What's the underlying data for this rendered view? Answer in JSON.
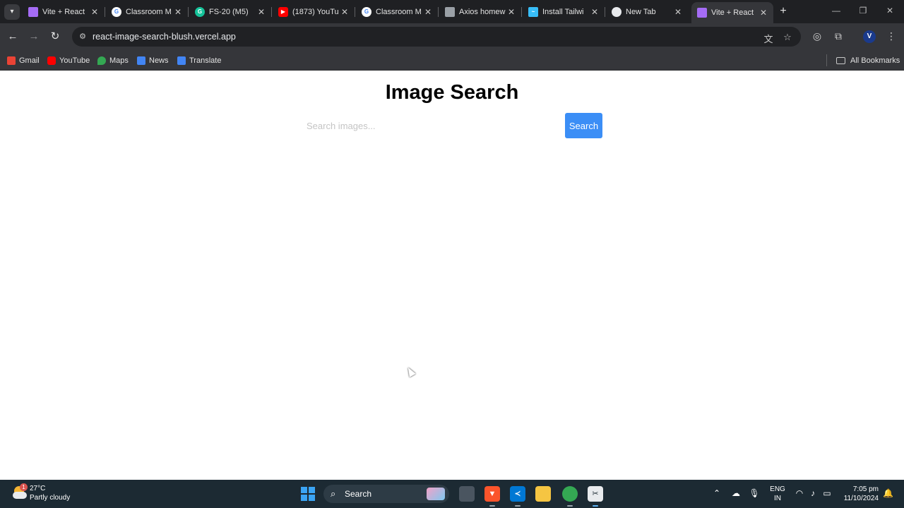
{
  "browser": {
    "tabs": [
      {
        "title": "Vite + React",
        "favicon": "vite-icon",
        "color": "#a56cf5"
      },
      {
        "title": "Classroom M",
        "favicon": "google-icon",
        "color": "#ffffff"
      },
      {
        "title": "FS-20 (M5)",
        "favicon": "grammarly-icon",
        "color": "#15c39a"
      },
      {
        "title": "(1873) YouTu",
        "favicon": "youtube-icon",
        "color": "#ff0000"
      },
      {
        "title": "Classroom M",
        "favicon": "google-icon",
        "color": "#ffffff"
      },
      {
        "title": "Axios homew",
        "favicon": "image-icon",
        "color": "#9aa0a6"
      },
      {
        "title": "Install Tailwi",
        "favicon": "tailwind-icon",
        "color": "#38bdf8"
      },
      {
        "title": "New Tab",
        "favicon": "chrome-icon",
        "color": "#e8eaed"
      },
      {
        "title": "Vite + React",
        "favicon": "vite-icon",
        "color": "#a56cf5",
        "active": true
      }
    ],
    "address_bar": {
      "url": "react-image-search-blush.vercel.app"
    },
    "bookmarks": [
      {
        "label": "Gmail",
        "color": "#ea4335"
      },
      {
        "label": "YouTube",
        "color": "#ff0000"
      },
      {
        "label": "Maps",
        "color": "#34a853"
      },
      {
        "label": "News",
        "color": "#4285f4"
      },
      {
        "label": "Translate",
        "color": "#4285f4"
      }
    ],
    "all_bookmarks_label": "All Bookmarks",
    "profile_initial": "V"
  },
  "page": {
    "title": "Image Search",
    "search": {
      "placeholder": "Search images...",
      "value": ""
    },
    "search_button_label": "Search",
    "accent_color": "#3b8ef6"
  },
  "taskbar": {
    "weather": {
      "temp": "27°C",
      "condition": "Partly cloudy",
      "badge": "1"
    },
    "search_label": "Search",
    "lang": {
      "line1": "ENG",
      "line2": "IN"
    },
    "clock": {
      "time": "7:05 pm",
      "date": "11/10/2024"
    }
  }
}
